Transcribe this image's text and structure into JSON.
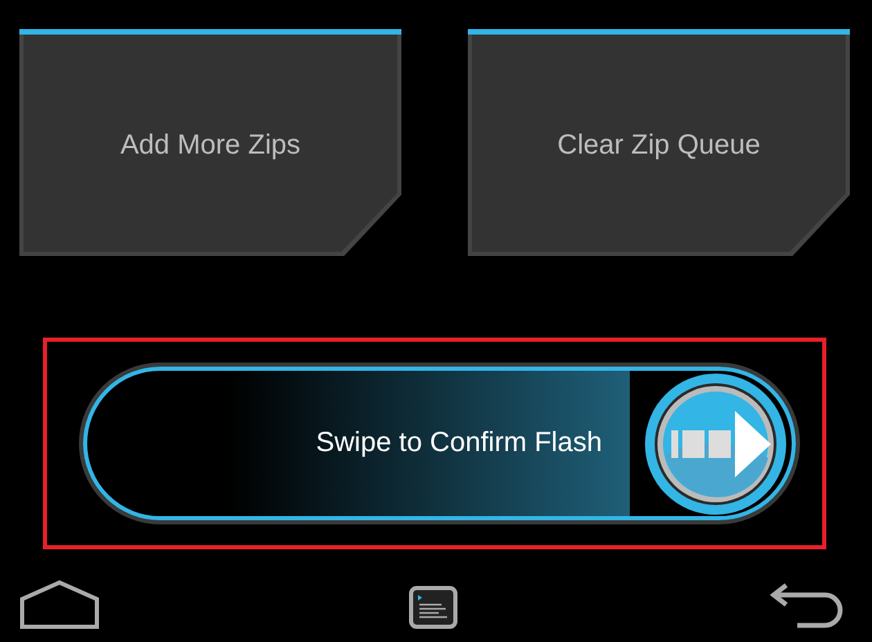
{
  "buttons": [
    {
      "label": "Add More Zips"
    },
    {
      "label": "Clear Zip Queue"
    }
  ],
  "swipe": {
    "label": "Swipe to Confirm Flash",
    "level": 1
  }
}
